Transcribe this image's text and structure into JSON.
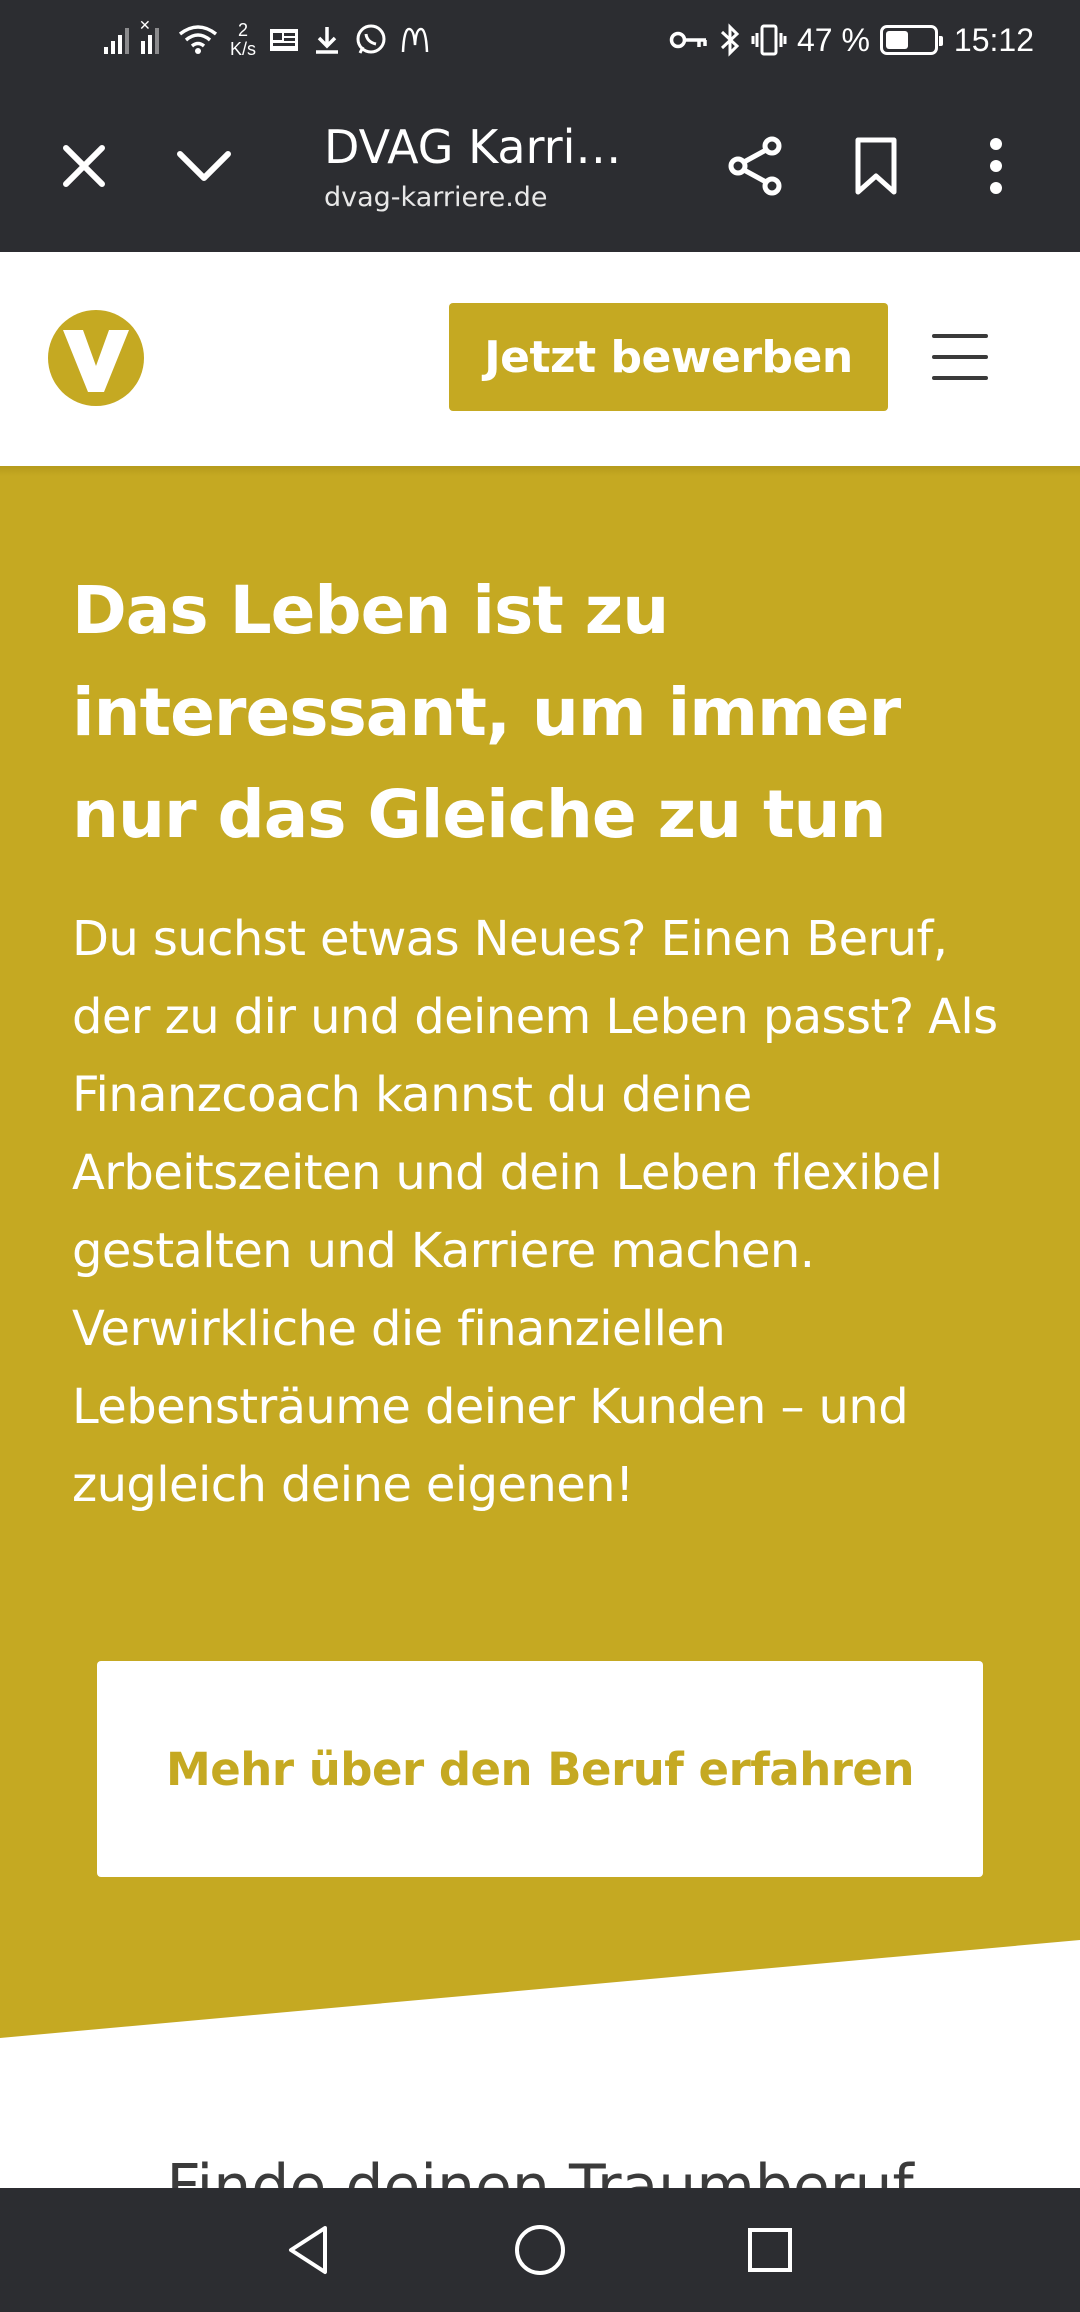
{
  "status_bar": {
    "net_speed_value": "2",
    "net_speed_unit": "K/s",
    "battery_percent": "47 %",
    "battery_level": 0.47,
    "time": "15:12"
  },
  "browser": {
    "title": "DVAG Karri…",
    "url": "dvag-karriere.de",
    "icons": {
      "close": "close-icon",
      "minimize": "chevron-down-icon",
      "share": "share-icon",
      "bookmark": "bookmark-icon",
      "more": "more-vert-icon"
    }
  },
  "site_header": {
    "logo": "dvag-logo",
    "apply_label": "Jetzt bewerben",
    "menu_icon": "hamburger-menu-icon"
  },
  "hero": {
    "title": "Das Leben ist zu interessant, um immer nur das Gleiche zu tun",
    "text": "Du suchst etwas Neues? Einen Beruf, der zu dir und deinem Leben passt? Als Finanzcoach kannst du deine Arbeitszeiten und dein Leben flexibel gestalten und Karriere machen. Verwirkliche die finanziellen Lebensträume deiner Kunden – und zugleich deine eigenen!",
    "button_label": "Mehr über den Beruf erfahren"
  },
  "next_section": {
    "heading": "Finde deinen Traumberuf"
  },
  "nav_bar": {
    "back": "back-triangle-icon",
    "home": "home-circle-icon",
    "recents": "recents-square-icon"
  },
  "colors": {
    "brand_gold": "#c5a922",
    "system_bar": "#2c2d31",
    "white": "#ffffff"
  }
}
